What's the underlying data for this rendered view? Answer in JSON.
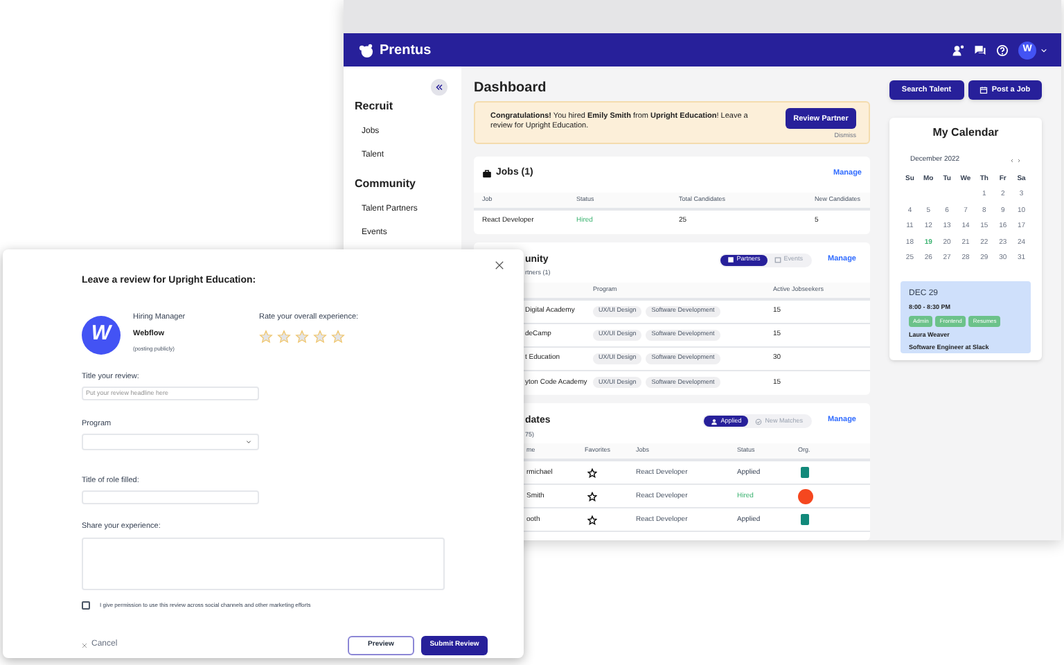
{
  "header": {
    "brand": "Prentus",
    "avatar": "W"
  },
  "sidebar": {
    "sections": [
      {
        "title": "Recruit",
        "items": [
          {
            "label": "Jobs"
          },
          {
            "label": "Talent"
          }
        ]
      },
      {
        "title": "Community",
        "items": [
          {
            "label": "Talent Partners"
          },
          {
            "label": "Events"
          }
        ]
      }
    ]
  },
  "page_title": "Dashboard",
  "banner": {
    "message": "**Congratulations!** You hired **Emily Smith** from **Upright Education**! Leave a review for Upright Education.",
    "button": "Review Partner",
    "dismiss": "Dismiss"
  },
  "jobs": {
    "title": "Jobs (1)",
    "manage": "Manage",
    "columns": [
      "Job",
      "Status",
      "Total Candidates",
      "New Candidates"
    ],
    "rows": [
      {
        "job": "React Developer",
        "status": "Hired",
        "highlighted": true,
        "total": "25",
        "new": "5"
      }
    ]
  },
  "community": {
    "title": "unity",
    "subtitle": "rtners (1)",
    "manage": "Manage",
    "toggle": [
      {
        "label": "Partners",
        "selected": true
      },
      {
        "label": "Events",
        "selected": false
      }
    ],
    "columns": [
      "Program",
      "Active Jobseekers"
    ],
    "rows": [
      {
        "name": "Digital Academy",
        "programs": [
          "UX/UI Design",
          "Software Development"
        ],
        "active": "15"
      },
      {
        "name": "deCamp",
        "programs": [
          "UX/UI Design",
          "Software Development"
        ],
        "active": "15"
      },
      {
        "name": "t Education",
        "programs": [
          "UX/UI Design",
          "Software Development"
        ],
        "active": "30"
      },
      {
        "name": "yton Code Academy",
        "programs": [
          "UX/UI Design",
          "Software Development"
        ],
        "active": "15"
      }
    ]
  },
  "candidates": {
    "title": "dates",
    "subtitle": "75)",
    "manage": "Manage",
    "toggle": [
      {
        "label": "Applied",
        "selected": true
      },
      {
        "label": "New Matches",
        "selected": false
      }
    ],
    "columns": [
      "me",
      "Favorites",
      "Jobs",
      "Status",
      "Org."
    ],
    "rows": [
      {
        "name": "rmichael",
        "favorite": false,
        "job": "React Developer",
        "status": "Applied",
        "highlighted": false,
        "org": {
          "kind": "square",
          "color": "#12897a"
        }
      },
      {
        "name": "Smith",
        "favorite": false,
        "job": "React Developer",
        "status": "Hired",
        "highlighted": true,
        "org": {
          "kind": "circle",
          "color": "#f5471f"
        }
      },
      {
        "name": "ooth",
        "favorite": false,
        "job": "React Developer",
        "status": "Applied",
        "highlighted": false,
        "org": {
          "kind": "square",
          "color": "#12897a"
        }
      }
    ]
  },
  "actions": [
    {
      "label": "Search Talent",
      "kind": "plain"
    },
    {
      "label": "Post a Job",
      "kind": "icon"
    }
  ],
  "calendar": {
    "title": "My Calendar",
    "month": "December 2022",
    "weekdays": [
      "Su",
      "Mo",
      "Tu",
      "We",
      "Th",
      "Fr",
      "Sa"
    ],
    "weeks": [
      [
        {
          "day": "1",
          "selected": false
        },
        {
          "day": "2",
          "selected": false
        },
        {
          "day": "3",
          "selected": false
        }
      ],
      [
        {
          "day": "4",
          "selected": false
        },
        {
          "day": "5",
          "selected": false
        },
        {
          "day": "6",
          "selected": false
        },
        {
          "day": "7",
          "selected": false
        },
        {
          "day": "8",
          "selected": false
        },
        {
          "day": "9",
          "selected": false
        },
        {
          "day": "10",
          "selected": false
        }
      ],
      [
        {
          "day": "11",
          "selected": false
        },
        {
          "day": "12",
          "selected": false
        },
        {
          "day": "13",
          "selected": false
        },
        {
          "day": "14",
          "selected": false
        },
        {
          "day": "15",
          "selected": false
        },
        {
          "day": "16",
          "selected": false
        },
        {
          "day": "17",
          "selected": false
        }
      ],
      [
        {
          "day": "18",
          "selected": false
        },
        {
          "day": "19",
          "selected": true
        },
        {
          "day": "20",
          "selected": false
        },
        {
          "day": "21",
          "selected": false
        },
        {
          "day": "22",
          "selected": false
        },
        {
          "day": "23",
          "selected": false
        },
        {
          "day": "24",
          "selected": false
        }
      ],
      [
        {
          "day": "25",
          "selected": false
        },
        {
          "day": "26",
          "selected": false
        },
        {
          "day": "27",
          "selected": false
        },
        {
          "day": "28",
          "selected": false
        },
        {
          "day": "29",
          "selected": false
        },
        {
          "day": "30",
          "selected": false
        },
        {
          "day": "31",
          "selected": false
        }
      ]
    ],
    "event": {
      "date": "DEC 29",
      "time": "8:00 - 8:30 PM",
      "tags": [
        "Admin",
        "Frontend",
        "Resumes"
      ],
      "person": "Laura Weaver",
      "role": "Software Engineer at Slack"
    }
  },
  "modal": {
    "title": "Leave a review for Upright Education:",
    "avatar": "W",
    "role": "Hiring Manager",
    "company": "Webflow",
    "note": "(posting publicly)",
    "rating_label": "Rate your overall experience:",
    "stars": 0,
    "fields": [
      {
        "label": "Title your review:",
        "kind": "text",
        "placeholder": "Put your review headline here"
      },
      {
        "label": "Program",
        "kind": "select"
      },
      {
        "label": "Title of role filled:",
        "kind": "text"
      },
      {
        "label": "Share your experience:",
        "kind": "textarea"
      }
    ],
    "consent": {
      "label": "I give permission to use this review across social channels and other marketing efforts",
      "checked": false
    },
    "cancel": "Cancel",
    "buttons": [
      {
        "label": "Preview",
        "kind": "secondary"
      },
      {
        "label": "Submit Review",
        "kind": "primary"
      }
    ]
  }
}
